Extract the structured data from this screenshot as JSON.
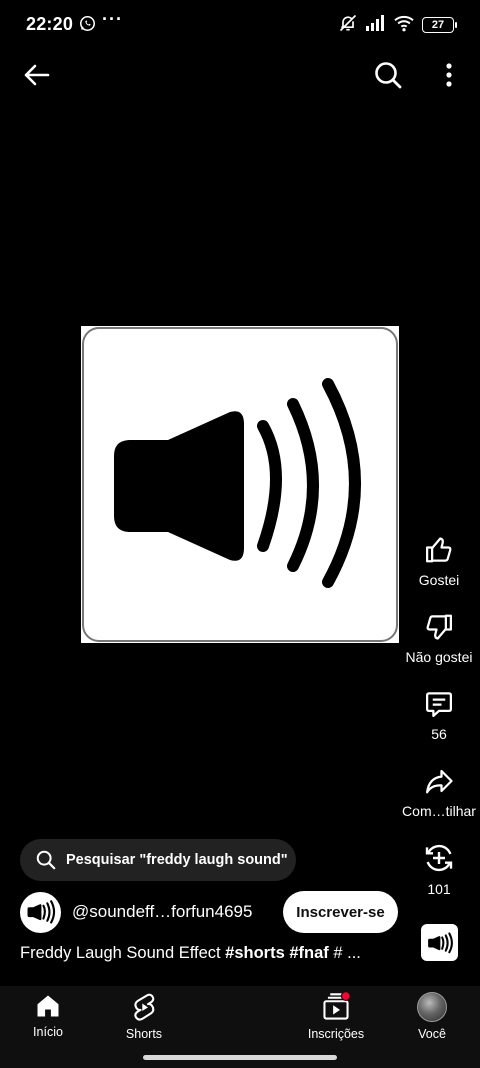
{
  "status_bar": {
    "time": "22:20",
    "overflow": "···",
    "battery": "27",
    "icons": [
      "whatsapp-icon",
      "mute-icon",
      "signal-icon",
      "wifi-icon",
      "battery-icon"
    ]
  },
  "top_bar": {
    "icons": [
      "back-arrow-icon",
      "search-icon",
      "more-vert-icon"
    ]
  },
  "video": {
    "thumbnail": "speaker-volume-icon"
  },
  "actions": {
    "like_label": "Gostei",
    "dislike_label": "Não gostei",
    "comments_count": "56",
    "share_label": "Com…tilhar",
    "remix_count": "101"
  },
  "search_suggestion": {
    "text": "Pesquisar \"freddy laugh sound\""
  },
  "channel": {
    "handle": "@soundeff…forfun4695",
    "subscribe_label": "Inscrever-se"
  },
  "title": {
    "text": "Freddy Laugh Sound Effect ",
    "tag1": "#shorts",
    "tag2": "#fnaf",
    "tail": " # ..."
  },
  "bottom_nav": {
    "home": "Início",
    "shorts": "Shorts",
    "subscriptions": "Inscrições",
    "you": "Você"
  },
  "colors": {
    "background": "#000000",
    "nav_background": "#0f0f0f",
    "pill_background": "#222222",
    "notification_dot": "#ff0033"
  }
}
